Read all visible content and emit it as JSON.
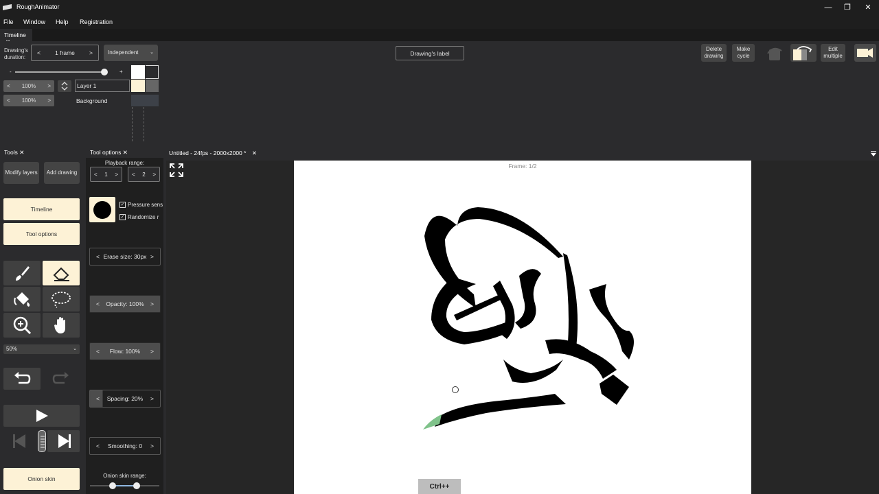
{
  "window": {
    "title": "RoughAnimator",
    "controls": [
      "—",
      "❐",
      "✕"
    ]
  },
  "menu": [
    "File",
    "Window",
    "Help",
    "Registration"
  ],
  "timeline": {
    "tab_label": "Timeline",
    "tab_close": "✕",
    "duration_label": "Drawing's duration:",
    "duration_value": "1 frame",
    "mode_value": "Independent",
    "drawing_label_button": "Drawing's label",
    "delete_drawing": "Delete drawing",
    "make_cycle": "Make cycle",
    "edit_multiple": "Edit multiple",
    "zoom_minus": "-",
    "zoom_plus": "+",
    "layers": [
      {
        "opacity": "100%",
        "name": "Layer 1"
      },
      {
        "opacity": "100%",
        "name": "Background"
      }
    ]
  },
  "tools_panel": {
    "tab_label": "Tools",
    "tab_close": "✕",
    "modify_layers": "Modify layers",
    "add_drawing": "Add drawing",
    "timeline_btn": "Timeline",
    "tool_options_btn": "Tool options",
    "zoom_select": "50%",
    "onion_skin": "Onion skin",
    "tools": [
      "brush-icon",
      "eraser-icon",
      "fill-bucket-icon",
      "lasso-icon",
      "zoom-icon",
      "hand-icon"
    ],
    "selected_tool": "eraser"
  },
  "options_panel": {
    "tab_label": "Tool options",
    "tab_close": "✕",
    "playback_range_label": "Playback range:",
    "playback_start": "1",
    "playback_end": "2",
    "pressure_label": "Pressure sens",
    "randomize_label": "Randomize r",
    "erase_size": "Erase size: 30px",
    "opacity": "Opacity: 100%",
    "flow": "Flow: 100%",
    "spacing": "Spacing: 20%",
    "smoothing": "Smoothing: 0",
    "onion_range_label": "Onion skin range:"
  },
  "document": {
    "tab_label": "Untitled - 24fps - 2000x2000 *",
    "tab_close": "✕",
    "frame_label": "Frame: 1/2",
    "shortcut_hint": "Ctrl++"
  },
  "colors": {
    "accent_cream": "#fdf2d6",
    "panel_bg": "#2b2b2d",
    "canvas_bg": "#ffffff",
    "ink": "#000000",
    "onion_green": "#7fc28a"
  }
}
